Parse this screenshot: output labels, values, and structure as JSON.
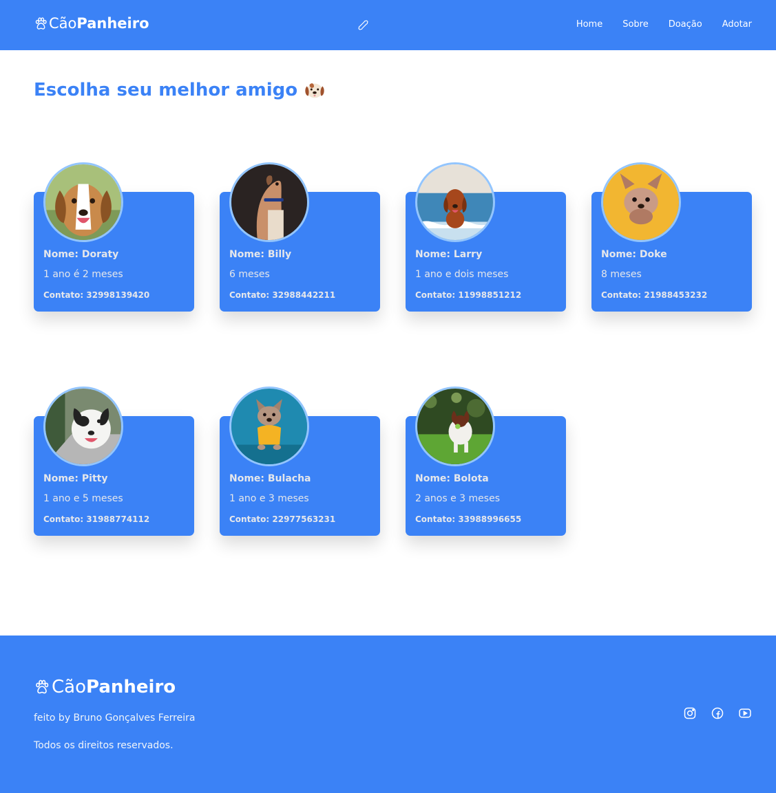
{
  "header": {
    "logo_light": "Cão",
    "logo_bold": "Panheiro",
    "nav": [
      "Home",
      "Sobre",
      "Doação",
      "Adotar"
    ]
  },
  "main": {
    "title": "Escolha seu melhor amigo"
  },
  "dogs": [
    {
      "name": "Nome: Doraty",
      "age": "1 ano é 2 meses",
      "contact": "Contato: 32998139420",
      "photo_bg": "#a8c07a"
    },
    {
      "name": "Nome: Billy",
      "age": "6 meses",
      "contact": "Contato: 32988442211",
      "photo_bg": "#2a2322"
    },
    {
      "name": "Nome: Larry",
      "age": "1 ano e dois meses",
      "contact": "Contato: 11998851212",
      "photo_bg": "#5aa0cc"
    },
    {
      "name": "Nome: Doke",
      "age": "8 meses",
      "contact": "Contato: 21988453232",
      "photo_bg": "#f2b631"
    },
    {
      "name": "Nome: Pitty",
      "age": "1 ano e 5 meses",
      "contact": "Contato: 31988774112",
      "photo_bg": "#7a8a70"
    },
    {
      "name": "Nome: Bulacha",
      "age": "1 ano e 3 meses",
      "contact": "Contato: 22977563231",
      "photo_bg": "#1f8ab0"
    },
    {
      "name": "Nome: Bolota",
      "age": "2 anos e 3 meses",
      "contact": "Contato: 33988996655",
      "photo_bg": "#3f7a2a"
    }
  ],
  "footer": {
    "logo_light": "Cão",
    "logo_bold": "Panheiro",
    "credit": "feito by Bruno Gonçalves Ferreira",
    "rights": "Todos os direitos reservados.",
    "socials": [
      "instagram-icon",
      "facebook-icon",
      "youtube-icon"
    ]
  },
  "colors": {
    "primary": "#3b82f6",
    "avatar_border": "#93c5fd"
  }
}
